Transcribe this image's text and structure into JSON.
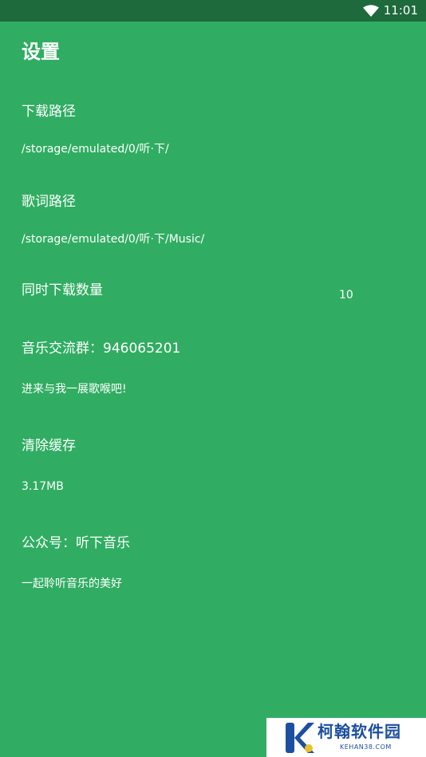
{
  "status_bar": {
    "time": "11:01",
    "wifi_icon": "wifi-icon"
  },
  "header": {
    "title": "设置"
  },
  "settings": [
    {
      "title": "下载路径",
      "subtitle": "/storage/emulated/0/听·下/"
    },
    {
      "title": "歌词路径",
      "subtitle": "/storage/emulated/0/听·下/Music/"
    },
    {
      "title": "同时下载数量",
      "value": "10"
    },
    {
      "title": "音乐交流群：946065201",
      "subtitle": "进来与我一展歌喉吧!"
    },
    {
      "title": "清除缓存",
      "subtitle": "3.17MB"
    },
    {
      "title": "公众号：听下音乐",
      "subtitle": "一起聆听音乐的美好"
    }
  ],
  "watermark": {
    "name": "柯翰软件园",
    "domain": "KEHAN38.COM"
  },
  "colors": {
    "background": "#30ad62",
    "status_bar": "#1e6a3c",
    "watermark_text": "#1c4fa0"
  }
}
